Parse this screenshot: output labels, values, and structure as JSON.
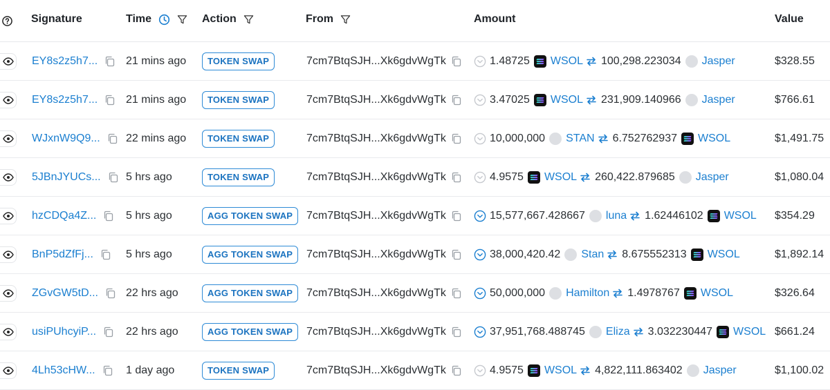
{
  "header": {
    "signature": "Signature",
    "time": "Time",
    "action": "Action",
    "from": "From",
    "amount": "Amount",
    "value": "Value"
  },
  "rows": [
    {
      "signature": "EY8s2z5h7...",
      "time": "21 mins ago",
      "action": "TOKEN SWAP",
      "from": "7cm7BtqSJH...Xk6gdvWgTk",
      "status": "grey",
      "amount1": "1.48725",
      "token1": "WSOL",
      "token1_logo": "wsol",
      "amount2": "100,298.223034",
      "token2": "Jasper",
      "token2_logo": "grey",
      "value": "$328.55"
    },
    {
      "signature": "EY8s2z5h7...",
      "time": "21 mins ago",
      "action": "TOKEN SWAP",
      "from": "7cm7BtqSJH...Xk6gdvWgTk",
      "status": "grey",
      "amount1": "3.47025",
      "token1": "WSOL",
      "token1_logo": "wsol",
      "amount2": "231,909.140966",
      "token2": "Jasper",
      "token2_logo": "grey",
      "value": "$766.61"
    },
    {
      "signature": "WJxnW9Q9...",
      "time": "22 mins ago",
      "action": "TOKEN SWAP",
      "from": "7cm7BtqSJH...Xk6gdvWgTk",
      "status": "grey",
      "amount1": "10,000,000",
      "token1": "STAN",
      "token1_logo": "grey",
      "amount2": "6.752762937",
      "token2": "WSOL",
      "token2_logo": "wsol",
      "value": "$1,491.75"
    },
    {
      "signature": "5JBnJYUCs...",
      "time": "5 hrs ago",
      "action": "TOKEN SWAP",
      "from": "7cm7BtqSJH...Xk6gdvWgTk",
      "status": "grey",
      "amount1": "4.9575",
      "token1": "WSOL",
      "token1_logo": "wsol",
      "amount2": "260,422.879685",
      "token2": "Jasper",
      "token2_logo": "grey",
      "value": "$1,080.04"
    },
    {
      "signature": "hzCDQa4Z...",
      "time": "5 hrs ago",
      "action": "AGG TOKEN SWAP",
      "from": "7cm7BtqSJH...Xk6gdvWgTk",
      "status": "blue",
      "amount1": "15,577,667.428667",
      "token1": "luna",
      "token1_logo": "grey",
      "amount2": "1.62446102",
      "token2": "WSOL",
      "token2_logo": "wsol",
      "value": "$354.29"
    },
    {
      "signature": "BnP5dZfFj...",
      "time": "5 hrs ago",
      "action": "AGG TOKEN SWAP",
      "from": "7cm7BtqSJH...Xk6gdvWgTk",
      "status": "blue",
      "amount1": "38,000,420.42",
      "token1": "Stan",
      "token1_logo": "grey",
      "amount2": "8.675552313",
      "token2": "WSOL",
      "token2_logo": "wsol",
      "value": "$1,892.14"
    },
    {
      "signature": "ZGvGW5tD...",
      "time": "22 hrs ago",
      "action": "AGG TOKEN SWAP",
      "from": "7cm7BtqSJH...Xk6gdvWgTk",
      "status": "blue",
      "amount1": "50,000,000",
      "token1": "Hamilton",
      "token1_logo": "grey",
      "amount2": "1.4978767",
      "token2": "WSOL",
      "token2_logo": "wsol",
      "value": "$326.64"
    },
    {
      "signature": "usiPUhcyiP...",
      "time": "22 hrs ago",
      "action": "AGG TOKEN SWAP",
      "from": "7cm7BtqSJH...Xk6gdvWgTk",
      "status": "blue",
      "amount1": "37,951,768.488745",
      "token1": "Eliza",
      "token1_logo": "grey",
      "amount2": "3.032230447",
      "token2": "WSOL",
      "token2_logo": "wsol",
      "value": "$661.24"
    },
    {
      "signature": "4Lh53cHW...",
      "time": "1 day ago",
      "action": "TOKEN SWAP",
      "from": "7cm7BtqSJH...Xk6gdvWgTk",
      "status": "grey",
      "amount1": "4.9575",
      "token1": "WSOL",
      "token1_logo": "wsol",
      "amount2": "4,822,111.863402",
      "token2": "Jasper",
      "token2_logo": "grey",
      "value": "$1,100.02"
    }
  ],
  "icons": {
    "help": "question-circle-icon",
    "clock": "clock-icon",
    "filter": "filter-icon",
    "eye": "eye-icon",
    "copy": "copy-icon",
    "swap": "swap-arrows-icon",
    "status": "chevron-circle-icon"
  },
  "colors": {
    "link": "#1b7fd0",
    "badge": "#2d8ad6",
    "status_blue": "#1b7fd0",
    "status_grey": "#c9ccd1"
  }
}
